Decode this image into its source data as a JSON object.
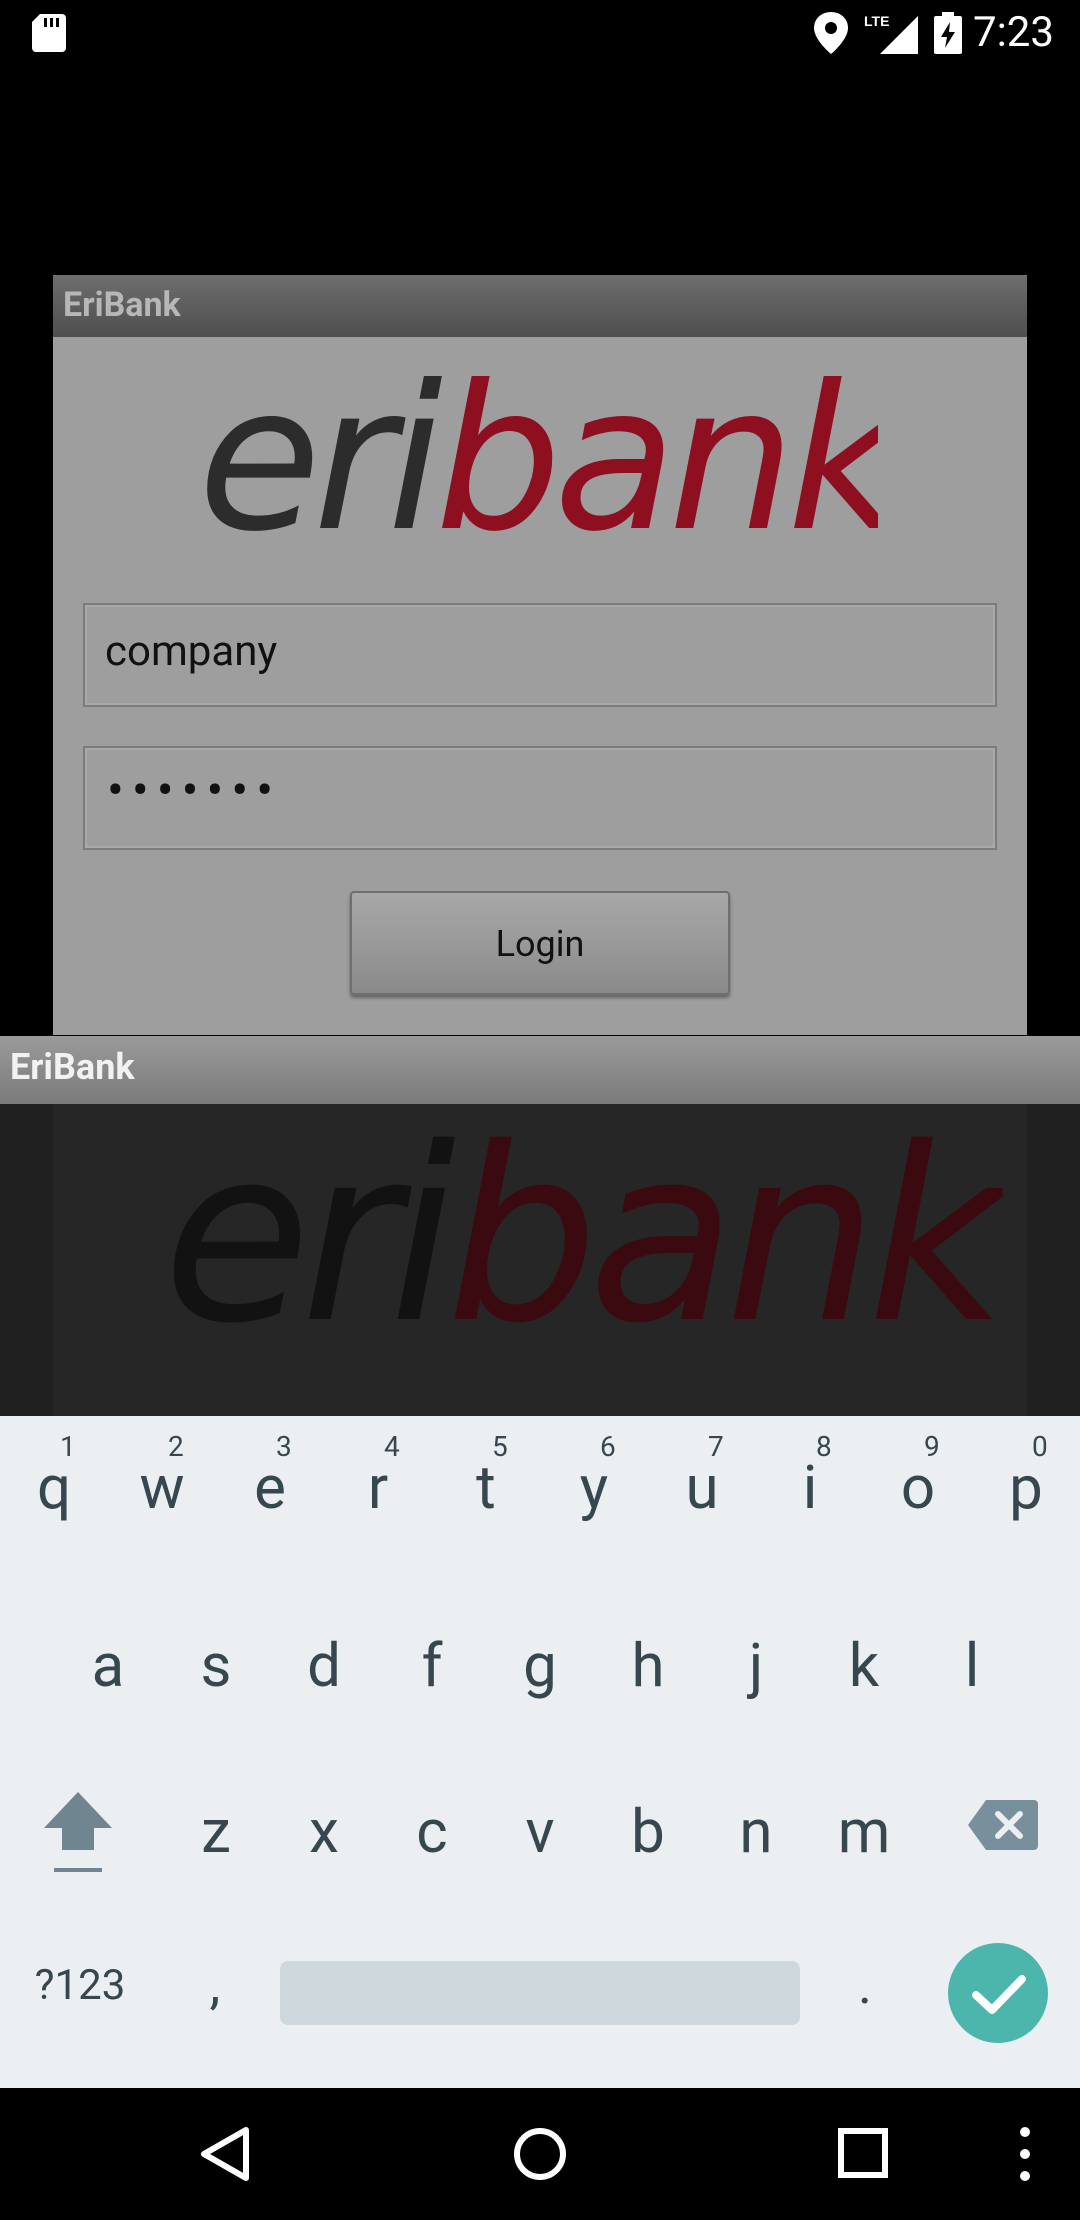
{
  "status_bar": {
    "time": "7:23",
    "network": "LTE"
  },
  "dialog": {
    "title": "EriBank",
    "logo_text_dark": "eri",
    "logo_text_red": "bank",
    "username_value": "company",
    "password_value": "•••••••",
    "login_label": "Login"
  },
  "window2": {
    "title": "EriBank",
    "logo_text_dark": "eri",
    "logo_text_red": "bank"
  },
  "keyboard": {
    "row1": [
      {
        "ch": "q",
        "hint": "1"
      },
      {
        "ch": "w",
        "hint": "2"
      },
      {
        "ch": "e",
        "hint": "3"
      },
      {
        "ch": "r",
        "hint": "4"
      },
      {
        "ch": "t",
        "hint": "5"
      },
      {
        "ch": "y",
        "hint": "6"
      },
      {
        "ch": "u",
        "hint": "7"
      },
      {
        "ch": "i",
        "hint": "8"
      },
      {
        "ch": "o",
        "hint": "9"
      },
      {
        "ch": "p",
        "hint": "0"
      }
    ],
    "row2": [
      "a",
      "s",
      "d",
      "f",
      "g",
      "h",
      "j",
      "k",
      "l"
    ],
    "row3": [
      "z",
      "x",
      "c",
      "v",
      "b",
      "n",
      "m"
    ],
    "symbols_label": "?123",
    "comma": ",",
    "period": "."
  },
  "colors": {
    "accent": "#4db6ac",
    "logo_red": "#b0122a",
    "keyboard_bg": "#eceff1"
  }
}
